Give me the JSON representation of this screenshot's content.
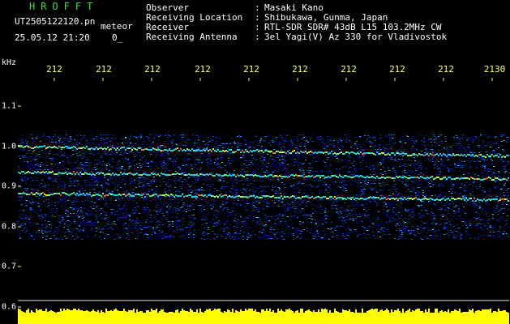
{
  "header": {
    "brand": "HROFFT",
    "filename": "UT2505122120.pn",
    "mode": "meteor",
    "timestamp": "25.05.12 21:20",
    "count": "0_",
    "info_rows": [
      {
        "label": "Observer",
        "sep": ":",
        "value": "Masaki Kano"
      },
      {
        "label": "Receiving Location",
        "sep": ":",
        "value": "Shibukawa, Gunma, Japan"
      },
      {
        "label": "Receiver",
        "sep": ":",
        "value": "RTL-SDR SDR# 43dB L15 103.2MHz CW"
      },
      {
        "label": "Receiving Antenna",
        "sep": ":",
        "value": "3el Yagi(V) Az 330 for Vladivostok"
      }
    ]
  },
  "axis": {
    "unit": "kHz",
    "x_ticks": [
      "212",
      "212",
      "212",
      "212",
      "212",
      "212",
      "212",
      "212",
      "212",
      "2130"
    ],
    "y_ticks": [
      "1.1",
      "1.0",
      "0.9",
      "0.8",
      "0.7",
      "0.6"
    ]
  },
  "colors": {
    "brand": "#3fdc3f",
    "x_tick_text": "#ffff66",
    "level_bar": "#ffff00",
    "tick_mark": "#ffff66"
  }
}
